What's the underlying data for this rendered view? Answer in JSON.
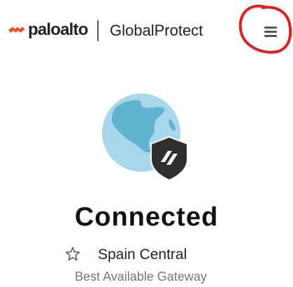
{
  "header": {
    "brand": "paloalto",
    "product": "GlobalProtect"
  },
  "status": {
    "state": "Connected"
  },
  "gateway": {
    "name": "Spain Central",
    "description": "Best Available Gateway"
  },
  "colors": {
    "brand_orange": "#f04e23",
    "globe_fill": "#a7d8ea",
    "globe_land": "#5fb3cf",
    "shield_dark": "#2f2f2f",
    "annotation_red": "#e02020"
  },
  "icons": {
    "menu": "hamburger-menu-icon",
    "globe": "globe-icon",
    "shield": "shield-icon",
    "star": "star-icon"
  }
}
